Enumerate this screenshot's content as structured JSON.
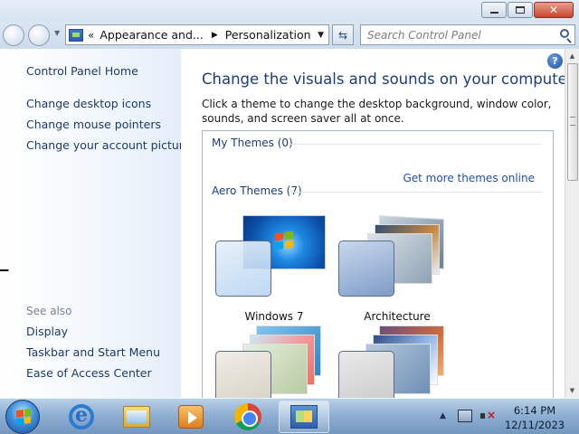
{
  "address": {
    "crumbs": [
      "Appearance and...",
      "Personalization"
    ],
    "prefix": "«"
  },
  "search": {
    "placeholder": "Search Control Panel"
  },
  "sidebar": {
    "home": "Control Panel Home",
    "tasks": [
      "Change desktop icons",
      "Change mouse pointers",
      "Change your account picture"
    ],
    "see_also_label": "See also",
    "see_also": [
      "Display",
      "Taskbar and Start Menu",
      "Ease of Access Center"
    ]
  },
  "main": {
    "title": "Change the visuals and sounds on your computer",
    "description": "Click a theme to change the desktop background, window color, sounds, and screen saver all at once.",
    "my_themes_label": "My Themes (0)",
    "get_more_link": "Get more themes online",
    "aero_themes_label": "Aero Themes (7)",
    "themes": [
      {
        "name": "Windows 7"
      },
      {
        "name": "Architecture"
      }
    ]
  },
  "taskbar": {
    "time": "6:14 PM",
    "date": "12/11/2023"
  },
  "colors": {
    "link": "#1c3a69",
    "title": "#1d3d7c",
    "taskbar": "#8fb0d3"
  },
  "icons": [
    "help-icon",
    "search-icon",
    "refresh-icon",
    "start-button",
    "internet-explorer-icon",
    "folder-icon",
    "media-player-icon",
    "chrome-icon",
    "control-panel-icon"
  ]
}
